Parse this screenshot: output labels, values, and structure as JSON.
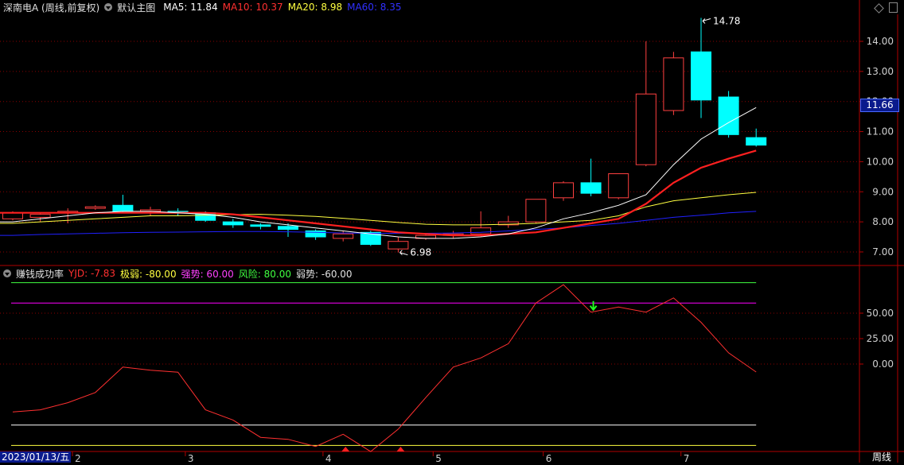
{
  "header": {
    "title": "深南电A (周线,前复权)",
    "template": "默认主图",
    "ma5_label": "MA5: 11.84",
    "ma10_label": "MA10: 10.37",
    "ma20_label": "MA20: 8.98",
    "ma60_label": "MA60: 8.35"
  },
  "indicator_header": {
    "name": "赚钱成功率",
    "yjd": "YJD: -7.83",
    "jiruo": "极弱: -80.00",
    "qiangshi": "强势: 60.00",
    "fengxian": "风险: 80.00",
    "ruoshi": "弱势: -60.00"
  },
  "price_tag": "11.66",
  "date_label": "2023/01/13/五",
  "period_button": "周线",
  "colors": {
    "up": "#ff4040",
    "down": "#00ffff",
    "ma5": "#ffffff",
    "ma10": "#ff2020",
    "ma20": "#ffff40",
    "ma60": "#2020ff",
    "grid": "#8b0000",
    "axis": "#b00000",
    "yjd": "#ff3030",
    "qiangshi": "#ff00ff",
    "fengxian": "#40ff40",
    "ruoshi": "#ffffff",
    "jiruo": "#ffff40"
  },
  "chart_data": [
    {
      "type": "candlestick",
      "yaxis_ticks": [
        "14.00",
        "13.00",
        "12.00",
        "11.00",
        "10.00",
        "9.00",
        "8.00",
        "7.00"
      ],
      "ylim": [
        6.5,
        15.0
      ],
      "x_ticks": [
        {
          "label": "2",
          "index": 2.4
        },
        {
          "label": "3",
          "index": 6.5
        },
        {
          "label": "4",
          "index": 11.5
        },
        {
          "label": "5",
          "index": 15.5
        },
        {
          "label": "6",
          "index": 19.5
        },
        {
          "label": "7",
          "index": 24.5
        }
      ],
      "annotations": [
        {
          "text": "14.78",
          "index": 25,
          "value": 14.78
        },
        {
          "text": "6.98",
          "index": 14,
          "value": 6.98
        }
      ],
      "candles": [
        {
          "o": 8.1,
          "h": 8.35,
          "l": 8.05,
          "c": 8.3
        },
        {
          "o": 8.15,
          "h": 8.3,
          "l": 8.0,
          "c": 8.25
        },
        {
          "o": 8.3,
          "h": 8.45,
          "l": 7.95,
          "c": 8.35
        },
        {
          "o": 8.45,
          "h": 8.55,
          "l": 8.4,
          "c": 8.5
        },
        {
          "o": 8.55,
          "h": 8.9,
          "l": 8.3,
          "c": 8.35
        },
        {
          "o": 8.35,
          "h": 8.5,
          "l": 8.2,
          "c": 8.4
        },
        {
          "o": 8.35,
          "h": 8.45,
          "l": 8.2,
          "c": 8.3
        },
        {
          "o": 8.3,
          "h": 8.35,
          "l": 8.0,
          "c": 8.05
        },
        {
          "o": 8.0,
          "h": 8.1,
          "l": 7.8,
          "c": 7.9
        },
        {
          "o": 7.9,
          "h": 7.95,
          "l": 7.75,
          "c": 7.85
        },
        {
          "o": 7.85,
          "h": 7.95,
          "l": 7.5,
          "c": 7.75
        },
        {
          "o": 7.7,
          "h": 7.75,
          "l": 7.4,
          "c": 7.5
        },
        {
          "o": 7.45,
          "h": 7.7,
          "l": 7.35,
          "c": 7.6
        },
        {
          "o": 7.65,
          "h": 7.7,
          "l": 7.2,
          "c": 7.25
        },
        {
          "o": 7.1,
          "h": 7.5,
          "l": 6.98,
          "c": 7.35
        },
        {
          "o": 7.45,
          "h": 7.6,
          "l": 7.4,
          "c": 7.55
        },
        {
          "o": 7.55,
          "h": 7.7,
          "l": 7.45,
          "c": 7.6
        },
        {
          "o": 7.6,
          "h": 8.35,
          "l": 7.5,
          "c": 7.8
        },
        {
          "o": 7.9,
          "h": 8.2,
          "l": 7.8,
          "c": 8.0
        },
        {
          "o": 8.0,
          "h": 8.75,
          "l": 7.95,
          "c": 8.75
        },
        {
          "o": 8.8,
          "h": 9.35,
          "l": 8.7,
          "c": 9.3
        },
        {
          "o": 9.3,
          "h": 10.1,
          "l": 8.85,
          "c": 8.95
        },
        {
          "o": 8.8,
          "h": 9.6,
          "l": 8.75,
          "c": 9.6
        },
        {
          "o": 9.9,
          "h": 14.0,
          "l": 9.85,
          "c": 12.25
        },
        {
          "o": 11.7,
          "h": 13.65,
          "l": 11.55,
          "c": 13.45
        },
        {
          "o": 13.65,
          "h": 14.78,
          "l": 11.45,
          "c": 12.05
        },
        {
          "o": 12.15,
          "h": 12.35,
          "l": 10.8,
          "c": 10.9
        },
        {
          "o": 10.8,
          "h": 11.1,
          "l": 10.5,
          "c": 10.55
        }
      ],
      "ma5": [
        8.0,
        8.1,
        8.2,
        8.3,
        8.35,
        8.35,
        8.3,
        8.25,
        8.15,
        8.0,
        7.9,
        7.8,
        7.7,
        7.6,
        7.5,
        7.45,
        7.45,
        7.5,
        7.6,
        7.8,
        8.1,
        8.3,
        8.55,
        8.9,
        9.9,
        10.75,
        11.3,
        11.8
      ],
      "ma10": [
        8.3,
        8.3,
        8.3,
        8.3,
        8.3,
        8.3,
        8.3,
        8.3,
        8.25,
        8.15,
        8.05,
        7.95,
        7.85,
        7.75,
        7.65,
        7.6,
        7.55,
        7.55,
        7.6,
        7.65,
        7.8,
        7.95,
        8.1,
        8.6,
        9.3,
        9.8,
        10.1,
        10.37
      ],
      "ma20": [
        7.95,
        8.0,
        8.05,
        8.1,
        8.15,
        8.2,
        8.2,
        8.22,
        8.24,
        8.25,
        8.22,
        8.18,
        8.12,
        8.05,
        7.98,
        7.92,
        7.9,
        7.9,
        7.92,
        7.95,
        8.0,
        8.05,
        8.2,
        8.5,
        8.7,
        8.8,
        8.9,
        8.98
      ],
      "ma60": [
        7.55,
        7.58,
        7.6,
        7.62,
        7.64,
        7.65,
        7.66,
        7.67,
        7.68,
        7.68,
        7.67,
        7.65,
        7.63,
        7.62,
        7.62,
        7.62,
        7.63,
        7.65,
        7.7,
        7.75,
        7.8,
        7.88,
        7.95,
        8.05,
        8.15,
        8.22,
        8.3,
        8.35
      ]
    },
    {
      "type": "line",
      "title": "赚钱成功率",
      "yaxis_ticks": [
        "50.00",
        "25.00",
        "0.00"
      ],
      "ylim": [
        -90,
        96
      ],
      "levels": {
        "fengxian": 80,
        "qiangshi": 60,
        "ruoshi": -60,
        "jiruo": -80
      },
      "yjd": [
        -47,
        -45,
        -38,
        -28,
        -3,
        -6,
        -8,
        -45,
        -55,
        -72,
        -74,
        -81,
        -69,
        -86,
        -64,
        -33,
        -3,
        6,
        20,
        60,
        78,
        51,
        56,
        51,
        65,
        41,
        11,
        -7.83
      ],
      "buy_markers": [
        12,
        14
      ],
      "sell_markers": [
        21
      ]
    }
  ]
}
